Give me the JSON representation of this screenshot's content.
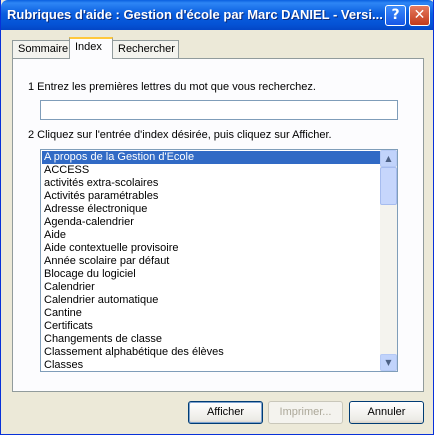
{
  "window": {
    "title": "Rubriques d'aide : Gestion d'école par Marc DANIEL - Versi...",
    "help_glyph": "?",
    "close_glyph": "✕"
  },
  "tabs": [
    {
      "label": "Sommaire",
      "active": false
    },
    {
      "label": "Index",
      "active": true
    },
    {
      "label": "Rechercher",
      "active": false
    }
  ],
  "index": {
    "step1": "1  Entrez les premières lettres du mot que vous recherchez.",
    "search_value": "",
    "step2": "2  Cliquez sur l'entrée d'index désirée, puis cliquez sur Afficher.",
    "items": [
      "A propos de la Gestion d'Ecole",
      "ACCESS",
      "activités extra-scolaires",
      "Activités paramétrables",
      "Adresse électronique",
      "Agenda-calendrier",
      "Aide",
      "Aide contextuelle provisoire",
      "Année scolaire par défaut",
      "Blocage du logiciel",
      "Calendrier",
      "Calendrier automatique",
      "Cantine",
      "Certificats",
      "Changements de classe",
      "Classement alphabétique des élèves",
      "Classes"
    ],
    "selected_index": 0,
    "scroll_up_glyph": "▲",
    "scroll_down_glyph": "▼"
  },
  "buttons": {
    "show": "Afficher",
    "print": "Imprimer...",
    "cancel": "Annuler"
  },
  "colors": {
    "titlebar": "#0453D6",
    "selection": "#316AC5",
    "dialog_bg": "#ECE9D8"
  }
}
